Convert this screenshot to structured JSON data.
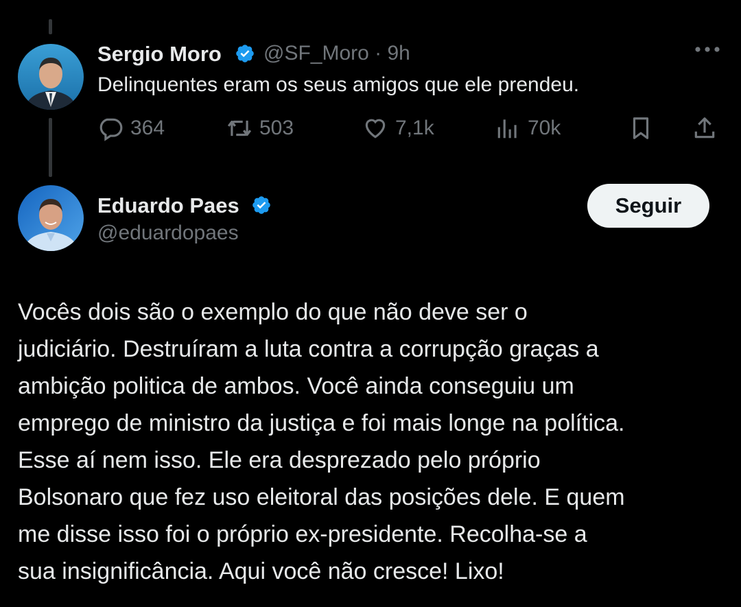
{
  "first_tweet": {
    "author_name": "Sergio Moro",
    "handle": "@SF_Moro",
    "time": "· 9h",
    "text": "Delinquentes eram os seus amigos que ele prendeu.",
    "stats": {
      "replies": "364",
      "retweets": "503",
      "likes": "7,1k",
      "views": "70k"
    },
    "icons": [
      "verified-badge-icon",
      "more-icon",
      "reply-icon",
      "retweet-icon",
      "like-icon",
      "views-icon",
      "bookmark-icon",
      "share-icon"
    ]
  },
  "second_tweet": {
    "author_name": "Eduardo Paes",
    "handle": "@eduardopaes",
    "follow_label": "Seguir",
    "lines": [
      "Vocês dois são o exemplo do que não deve ser o",
      "judiciário. Destruíram a luta contra a corrupção graças a",
      "ambição politica de ambos. Você ainda conseguiu um",
      "emprego de ministro da justiça e foi mais longe na política.",
      "Esse aí nem isso. Ele era desprezado pelo próprio",
      "Bolsonaro que fez uso eleitoral das posições dele. E quem",
      "me disse isso foi o próprio ex-presidente. Recolha-se a",
      "sua insignificância. Aqui você não cresce! Lixo!"
    ]
  },
  "colors": {
    "background": "#000000",
    "text": "#e7e9ea",
    "muted": "#71767b",
    "verified": "#1d9bf0",
    "follow_button": "#eff3f4"
  }
}
